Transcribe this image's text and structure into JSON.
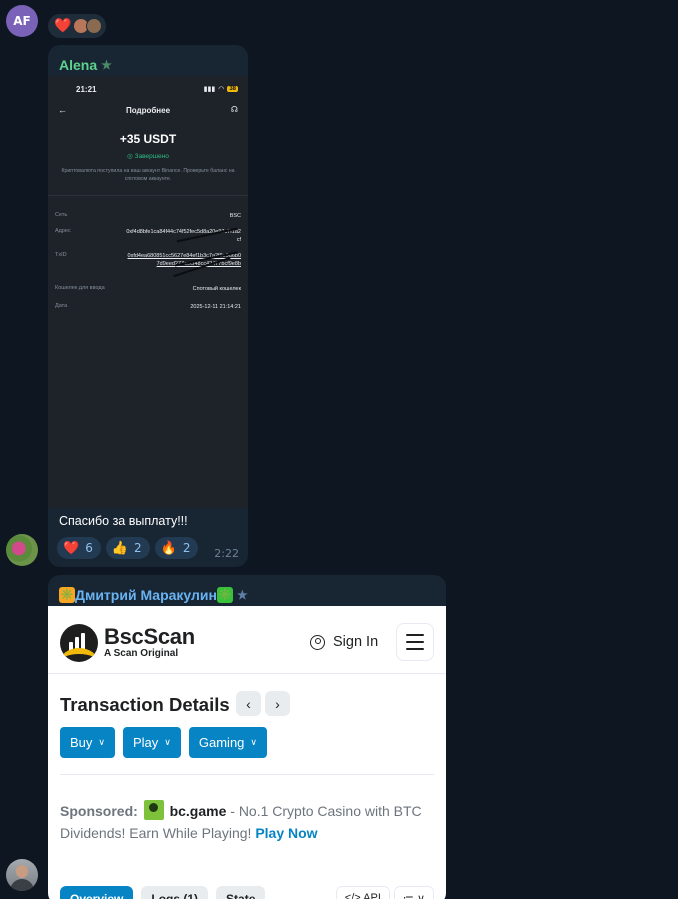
{
  "chat": {
    "avatar_initials": "AF",
    "message1": {
      "sender": "Alena",
      "caption": "Спасибо за выплату!!!",
      "time": "2:22",
      "reactions": [
        {
          "emoji": "❤️",
          "count": "6"
        },
        {
          "emoji": "👍",
          "count": "2"
        },
        {
          "emoji": "🔥",
          "count": "2"
        }
      ]
    },
    "message2": {
      "sender": "Дмитрий Маракулин",
      "emoji_left": "✳️",
      "emoji_right": "✳️"
    },
    "top_reaction_emoji": "❤️"
  },
  "phone": {
    "clock": "21:21",
    "battery": "38",
    "title": "Подробнее",
    "amount": "+35 USDT",
    "status": "Завершено",
    "note": "Криптовалюта поступила на ваш аккаунт Binance. Проверьте баланс на спотовом аккаунте.",
    "rows": [
      {
        "label": "Сеть",
        "value": "BSC"
      },
      {
        "label": "Адрес",
        "value": "0xf4d8bfe1ca84f44c74f52fec5d8a20e97c7f1a2cf"
      },
      {
        "label": "TxID",
        "value": "0xfd4ea680851cc5627e84ef1b3c7a2f8e9d6b07d9eed277eecf48cc42477bcf9e8b"
      },
      {
        "label": "Кошелек для ввода",
        "value": "Спотовый кошелек"
      },
      {
        "label": "Дата",
        "value": "2025-12-11 21:14:21"
      }
    ]
  },
  "bscscan": {
    "brand": "BscScan",
    "tagline": "A Scan Original",
    "signin": "Sign In",
    "title": "Transaction Details",
    "pills": [
      "Buy",
      "Play",
      "Gaming"
    ],
    "sponsored_label": "Sponsored:",
    "sponsor_name": "bc.game",
    "sponsor_text": " - No.1 Crypto Casino with BTC Dividends! Earn While Playing! ",
    "sponsor_cta": "Play Now",
    "tabs": [
      "Overview",
      "Logs (1)",
      "State"
    ],
    "right_buttons": [
      "</> API",
      "≔ ∨"
    ],
    "colors": {
      "primary": "#0784c3",
      "accent": "#f0b90b"
    }
  }
}
